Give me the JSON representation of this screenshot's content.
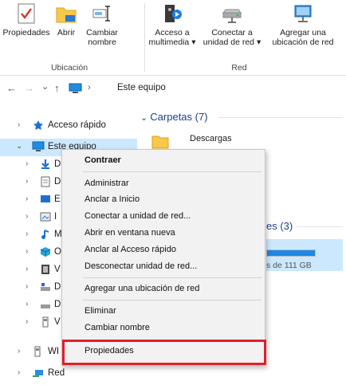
{
  "ribbon": {
    "ubicacion_group": "Ubicación",
    "red_group": "Red",
    "buttons": {
      "propiedades": "Propiedades",
      "abrir": "Abrir",
      "cambiar": "Cambiar",
      "nombre": "nombre",
      "acceso_a": "Acceso a",
      "multimedia": "multimedia",
      "conectar_a": "Conectar a",
      "unidad_red": "unidad de red",
      "agregar_una": "Agregar una",
      "ubicacion_red": "ubicación de red"
    },
    "dropdown_arrow": "▾"
  },
  "address": {
    "back": "←",
    "forward": "→",
    "recent": "⌄",
    "up": "↑",
    "separator": "›",
    "path": "Este equipo"
  },
  "tree": {
    "acceso_rapido": "Acceso rápido",
    "este_equipo": "Este equipo",
    "sub_letters": [
      "D",
      "D",
      "E",
      "I",
      "M",
      "O",
      "V",
      "D",
      "D",
      "V"
    ],
    "wi": "WI",
    "red": "Red"
  },
  "content": {
    "carpetas_header": "Carpetas (7)",
    "descargas": "Descargas",
    "devices_partial": "es (3)",
    "drive_free_partial": "s de 111 GB"
  },
  "context_menu": {
    "contraer": "Contraer",
    "administrar": "Administrar",
    "anclar_inicio": "Anclar a Inicio",
    "conectar_unidad": "Conectar a unidad de red...",
    "abrir_ventana": "Abrir en ventana nueva",
    "anclar_acceso": "Anclar al Acceso rápido",
    "desconectar": "Desconectar unidad de red...",
    "agregar_ubicacion": "Agregar una ubicación de red",
    "eliminar": "Eliminar",
    "cambiar_nombre": "Cambiar nombre",
    "propiedades": "Propiedades"
  },
  "colors": {
    "accent_blue": "#0078d7",
    "selection": "#cce8ff",
    "highlight_red": "#e0202a",
    "folder_yellow": "#f8c84a"
  }
}
